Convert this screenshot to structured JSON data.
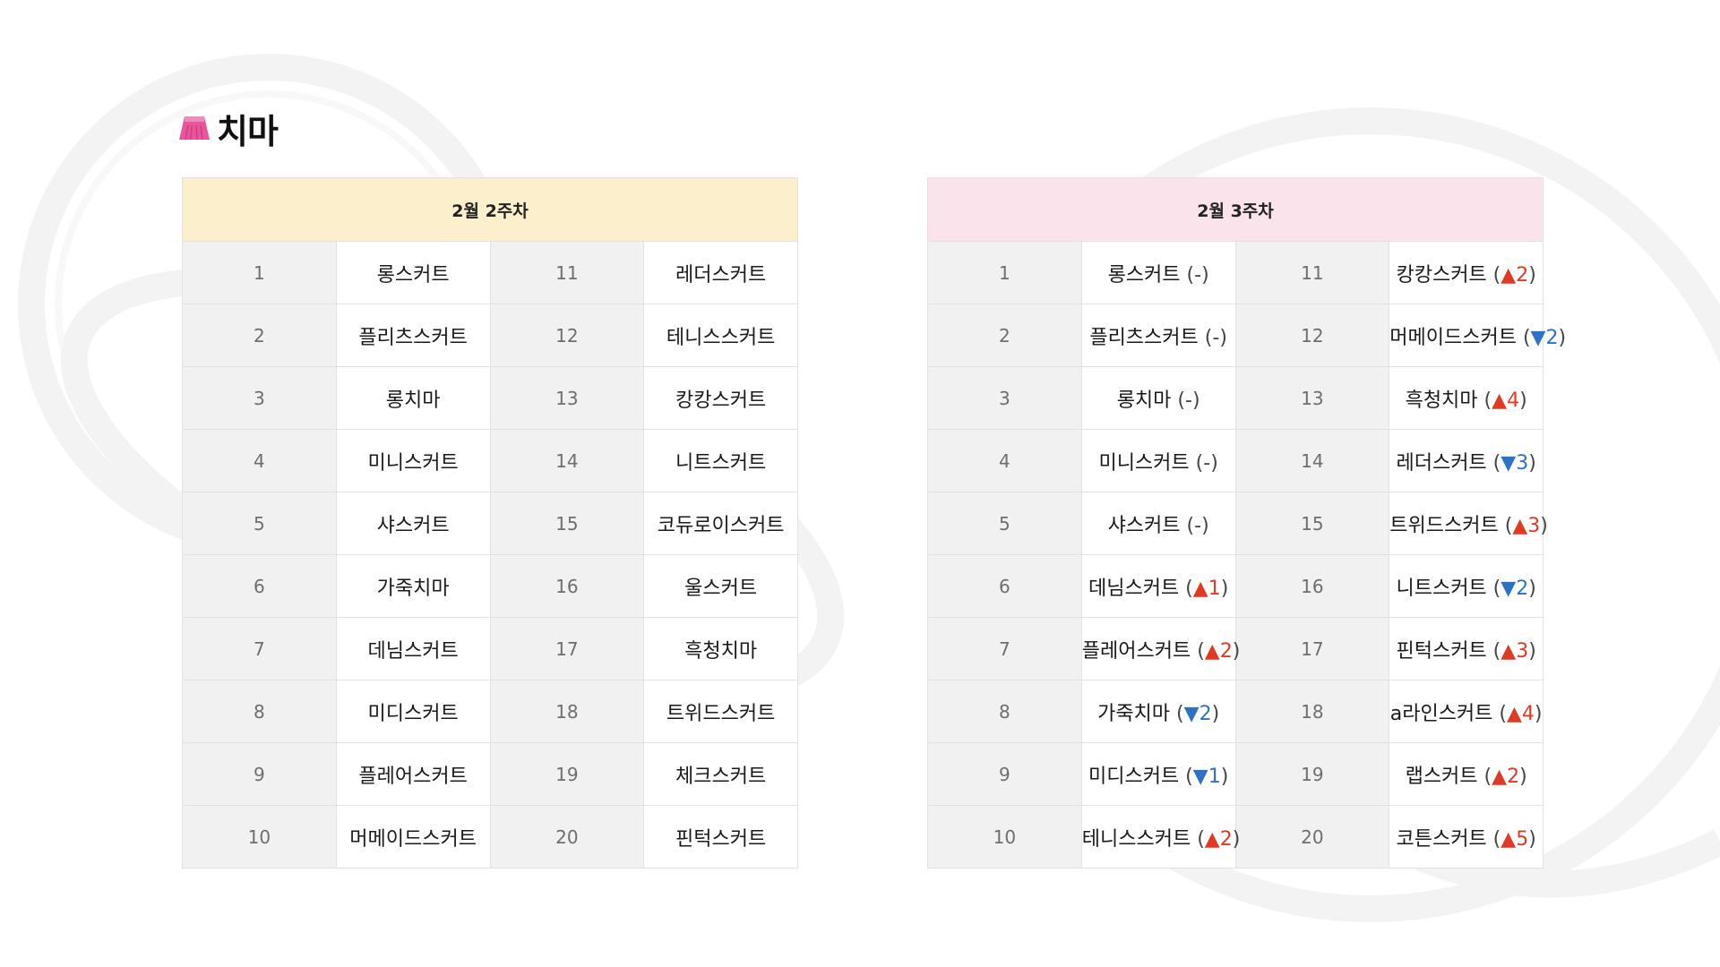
{
  "section": {
    "title": "치마",
    "icon": "skirt-icon",
    "icon_color": "#e8559a"
  },
  "colors": {
    "header_week2_bg": "#fcf0cc",
    "header_week3_bg": "#fbe3ec",
    "rank_cell_bg": "#f1f1f1",
    "up_color": "#e03a24",
    "down_color": "#2c73c4"
  },
  "tables": [
    {
      "title": "2월 2주차",
      "rows": [
        {
          "rank_left": "1",
          "item_left": "롱스커트",
          "rank_right": "11",
          "item_right": "레더스커트"
        },
        {
          "rank_left": "2",
          "item_left": "플리츠스커트",
          "rank_right": "12",
          "item_right": "테니스스커트"
        },
        {
          "rank_left": "3",
          "item_left": "롱치마",
          "rank_right": "13",
          "item_right": "캉캉스커트"
        },
        {
          "rank_left": "4",
          "item_left": "미니스커트",
          "rank_right": "14",
          "item_right": "니트스커트"
        },
        {
          "rank_left": "5",
          "item_left": "샤스커트",
          "rank_right": "15",
          "item_right": "코듀로이스커트"
        },
        {
          "rank_left": "6",
          "item_left": "가죽치마",
          "rank_right": "16",
          "item_right": "울스커트"
        },
        {
          "rank_left": "7",
          "item_left": "데님스커트",
          "rank_right": "17",
          "item_right": "흑청치마"
        },
        {
          "rank_left": "8",
          "item_left": "미디스커트",
          "rank_right": "18",
          "item_right": "트위드스커트"
        },
        {
          "rank_left": "9",
          "item_left": "플레어스커트",
          "rank_right": "19",
          "item_right": "체크스커트"
        },
        {
          "rank_left": "10",
          "item_left": "머메이드스커트",
          "rank_right": "20",
          "item_right": "핀턱스커트"
        }
      ]
    },
    {
      "title": "2월 3주차",
      "rows": [
        {
          "rank_left": "1",
          "item_left": "롱스커트",
          "change_left": {
            "open": "(",
            "sym": "-",
            "val": "",
            "close": ")",
            "dir": "same"
          },
          "rank_right": "11",
          "item_right": "캉캉스커트",
          "change_right": {
            "open": "(",
            "sym": "▲",
            "val": "2",
            "close": ")",
            "dir": "up"
          }
        },
        {
          "rank_left": "2",
          "item_left": "플리츠스커트",
          "change_left": {
            "open": "(",
            "sym": "-",
            "val": "",
            "close": ")",
            "dir": "same"
          },
          "rank_right": "12",
          "item_right": "머메이드스커트",
          "change_right": {
            "open": "(",
            "sym": "▼",
            "val": "2",
            "close": ")",
            "dir": "down"
          }
        },
        {
          "rank_left": "3",
          "item_left": "롱치마",
          "change_left": {
            "open": "(",
            "sym": "-",
            "val": "",
            "close": ")",
            "dir": "same"
          },
          "rank_right": "13",
          "item_right": "흑청치마",
          "change_right": {
            "open": "(",
            "sym": "▲",
            "val": "4",
            "close": ")",
            "dir": "up"
          }
        },
        {
          "rank_left": "4",
          "item_left": "미니스커트",
          "change_left": {
            "open": "(",
            "sym": "-",
            "val": "",
            "close": ")",
            "dir": "same"
          },
          "rank_right": "14",
          "item_right": "레더스커트",
          "change_right": {
            "open": "(",
            "sym": "▼",
            "val": "3",
            "close": ")",
            "dir": "down"
          }
        },
        {
          "rank_left": "5",
          "item_left": "샤스커트",
          "change_left": {
            "open": "(",
            "sym": "-",
            "val": "",
            "close": ")",
            "dir": "same"
          },
          "rank_right": "15",
          "item_right": "트위드스커트",
          "change_right": {
            "open": "(",
            "sym": "▲",
            "val": "3",
            "close": ")",
            "dir": "up"
          }
        },
        {
          "rank_left": "6",
          "item_left": "데님스커트",
          "change_left": {
            "open": "(",
            "sym": "▲",
            "val": "1",
            "close": ")",
            "dir": "up"
          },
          "rank_right": "16",
          "item_right": "니트스커트",
          "change_right": {
            "open": "(",
            "sym": "▼",
            "val": "2",
            "close": ")",
            "dir": "down"
          }
        },
        {
          "rank_left": "7",
          "item_left": "플레어스커트",
          "change_left": {
            "open": "(",
            "sym": "▲",
            "val": "2",
            "close": ")",
            "dir": "up"
          },
          "rank_right": "17",
          "item_right": "핀턱스커트",
          "change_right": {
            "open": "(",
            "sym": "▲",
            "val": "3",
            "close": ")",
            "dir": "up"
          }
        },
        {
          "rank_left": "8",
          "item_left": "가죽치마",
          "change_left": {
            "open": "(",
            "sym": "▼",
            "val": "2",
            "close": ")",
            "dir": "down"
          },
          "rank_right": "18",
          "item_right": "a라인스커트",
          "change_right": {
            "open": "(",
            "sym": "▲",
            "val": "4",
            "close": ")",
            "dir": "up"
          }
        },
        {
          "rank_left": "9",
          "item_left": "미디스커트",
          "change_left": {
            "open": "(",
            "sym": "▼",
            "val": "1",
            "close": ")",
            "dir": "down"
          },
          "rank_right": "19",
          "item_right": "랩스커트",
          "change_right": {
            "open": "(",
            "sym": "▲",
            "val": "2",
            "close": ")",
            "dir": "up"
          }
        },
        {
          "rank_left": "10",
          "item_left": "테니스스커트",
          "change_left": {
            "open": "(",
            "sym": "▲",
            "val": "2",
            "close": ")",
            "dir": "up"
          },
          "rank_right": "20",
          "item_right": "코튼스커트",
          "change_right": {
            "open": "(",
            "sym": "▲",
            "val": "5",
            "close": ")",
            "dir": "up"
          }
        }
      ]
    }
  ]
}
